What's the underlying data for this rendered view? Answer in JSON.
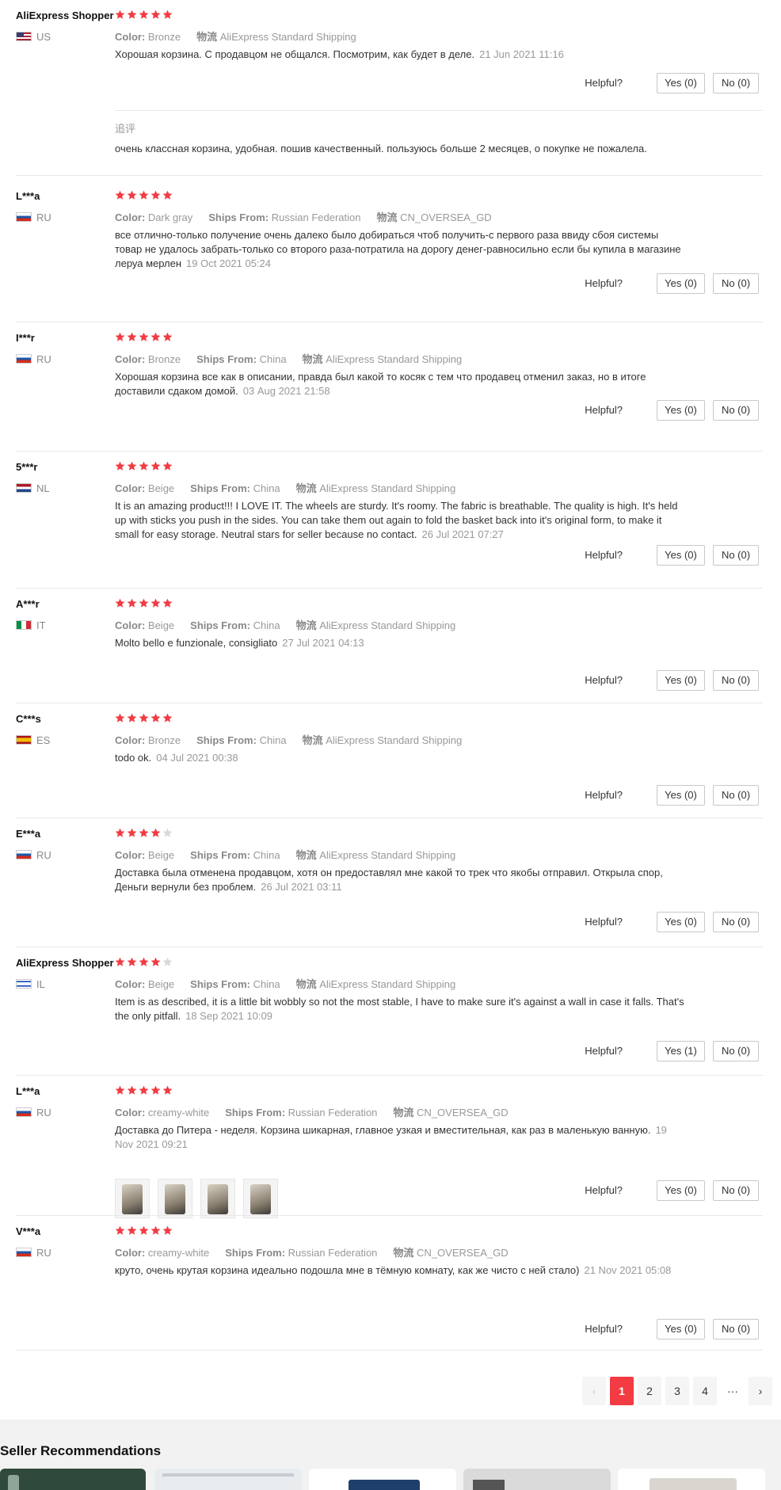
{
  "helpful_label": "Helpful?",
  "star_colors": {
    "filled": "#f23b42",
    "empty": "#d9d9d9"
  },
  "reviews": [
    {
      "name": "AliExpress Shopper",
      "country": "US",
      "flag": "us-flag",
      "stars": 5,
      "meta": [
        {
          "label": "Color:",
          "value": "Bronze"
        },
        {
          "label": "物流",
          "value": "AliExpress Standard Shipping"
        }
      ],
      "text": "Хорошая корзина. С продавцом не общался. Посмотрим, как будет в деле.",
      "date": "21 Jun 2021 11:16",
      "yes": "Yes (0)",
      "no": "No (0)",
      "followup_label": "追评",
      "followup_text": "очень классная корзина, удобная. пошив качественный. пользуюсь больше 2 месяцев, о покупке не пожалела."
    },
    {
      "name": "L***a",
      "country": "RU",
      "flag": "ru-flag",
      "stars": 5,
      "meta": [
        {
          "label": "Color:",
          "value": "Dark gray"
        },
        {
          "label": "Ships From:",
          "value": "Russian Federation"
        },
        {
          "label": "物流",
          "value": "CN_OVERSEA_GD"
        }
      ],
      "text": "все отлично-только получение очень далеко было добираться чтоб получить-с первого раза ввиду сбоя системы товар не удалось забрать-только со второго раза-потратила на дорогу денег-равносильно если бы купила в магазине леруа мерлен",
      "date": "19 Oct 2021 05:24",
      "yes": "Yes (0)",
      "no": "No (0)"
    },
    {
      "name": "I***r",
      "country": "RU",
      "flag": "ru-flag",
      "stars": 5,
      "meta": [
        {
          "label": "Color:",
          "value": "Bronze"
        },
        {
          "label": "Ships From:",
          "value": "China"
        },
        {
          "label": "物流",
          "value": "AliExpress Standard Shipping"
        }
      ],
      "text": "Хорошая корзина все как в описании, правда был какой то косяк с тем что продавец отменил заказ, но в итоге доставили сдаком домой.",
      "date": "03 Aug 2021 21:58",
      "yes": "Yes (0)",
      "no": "No (0)"
    },
    {
      "name": "5***r",
      "country": "NL",
      "flag": "nl-flag",
      "stars": 5,
      "meta": [
        {
          "label": "Color:",
          "value": "Beige"
        },
        {
          "label": "Ships From:",
          "value": "China"
        },
        {
          "label": "物流",
          "value": "AliExpress Standard Shipping"
        }
      ],
      "text": "It is an amazing product!!! I LOVE IT. The wheels are sturdy. It's roomy. The fabric is breathable. The quality is high. It's held up with sticks you push in the sides. You can take them out again to fold the basket back into it's original form, to make it small for easy storage. Neutral stars for seller because no contact.",
      "date": "26 Jul 2021 07:27",
      "yes": "Yes (0)",
      "no": "No (0)"
    },
    {
      "name": "A***r",
      "country": "IT",
      "flag": "it-flag",
      "stars": 5,
      "meta": [
        {
          "label": "Color:",
          "value": "Beige"
        },
        {
          "label": "Ships From:",
          "value": "China"
        },
        {
          "label": "物流",
          "value": "AliExpress Standard Shipping"
        }
      ],
      "text": "Molto bello e funzionale, consigliato",
      "date": "27 Jul 2021 04:13",
      "yes": "Yes (0)",
      "no": "No (0)"
    },
    {
      "name": "C***s",
      "country": "ES",
      "flag": "es-flag",
      "stars": 5,
      "meta": [
        {
          "label": "Color:",
          "value": "Bronze"
        },
        {
          "label": "Ships From:",
          "value": "China"
        },
        {
          "label": "物流",
          "value": "AliExpress Standard Shipping"
        }
      ],
      "text": "todo ok.",
      "date": "04 Jul 2021 00:38",
      "yes": "Yes (0)",
      "no": "No (0)"
    },
    {
      "name": "E***a",
      "country": "RU",
      "flag": "ru-flag",
      "stars": 4,
      "meta": [
        {
          "label": "Color:",
          "value": "Beige"
        },
        {
          "label": "Ships From:",
          "value": "China"
        },
        {
          "label": "物流",
          "value": "AliExpress Standard Shipping"
        }
      ],
      "text": "Доставка была отменена продавцом, хотя он предоставлял мне какой то трек что якобы отправил. Открыла спор, Деньги вернули без проблем.",
      "date": "26 Jul 2021 03:11",
      "yes": "Yes (0)",
      "no": "No (0)"
    },
    {
      "name": "AliExpress Shopper",
      "country": "IL",
      "flag": "il-flag",
      "stars": 4,
      "meta": [
        {
          "label": "Color:",
          "value": "Beige"
        },
        {
          "label": "Ships From:",
          "value": "China"
        },
        {
          "label": "物流",
          "value": "AliExpress Standard Shipping"
        }
      ],
      "text": "Item is as described, it is a little bit wobbly so not the most stable, I have to make sure it's against a wall in case it falls. That's the only pitfall.",
      "date": "18 Sep 2021 10:09",
      "yes": "Yes (1)",
      "no": "No (0)"
    },
    {
      "name": "L***a",
      "country": "RU",
      "flag": "ru-flag",
      "stars": 5,
      "meta": [
        {
          "label": "Color:",
          "value": "creamy-white"
        },
        {
          "label": "Ships From:",
          "value": "Russian Federation"
        },
        {
          "label": "物流",
          "value": "CN_OVERSEA_GD"
        }
      ],
      "text": "Доставка до Питера - неделя. Корзина шикарная, главное узкая и вместительная, как раз в маленькую ванную.",
      "date": "19 Nov 2021 09:21",
      "yes": "Yes (0)",
      "no": "No (0)",
      "photos": 4
    },
    {
      "name": "V***a",
      "country": "RU",
      "flag": "ru-flag",
      "stars": 5,
      "meta": [
        {
          "label": "Color:",
          "value": "creamy-white"
        },
        {
          "label": "Ships From:",
          "value": "Russian Federation"
        },
        {
          "label": "物流",
          "value": "CN_OVERSEA_GD"
        }
      ],
      "text": "круто, очень крутая корзина идеально подошла мне в тёмную комнату, как же чисто с ней стало)",
      "date": "21 Nov 2021 05:08",
      "yes": "Yes (0)",
      "no": "No (0)"
    }
  ],
  "pagination": {
    "prev": "‹",
    "pages": [
      "1",
      "2",
      "3",
      "4"
    ],
    "ellipsis": "···",
    "next": "›",
    "current": "1"
  },
  "recommendations": {
    "title": "Seller Recommendations"
  }
}
